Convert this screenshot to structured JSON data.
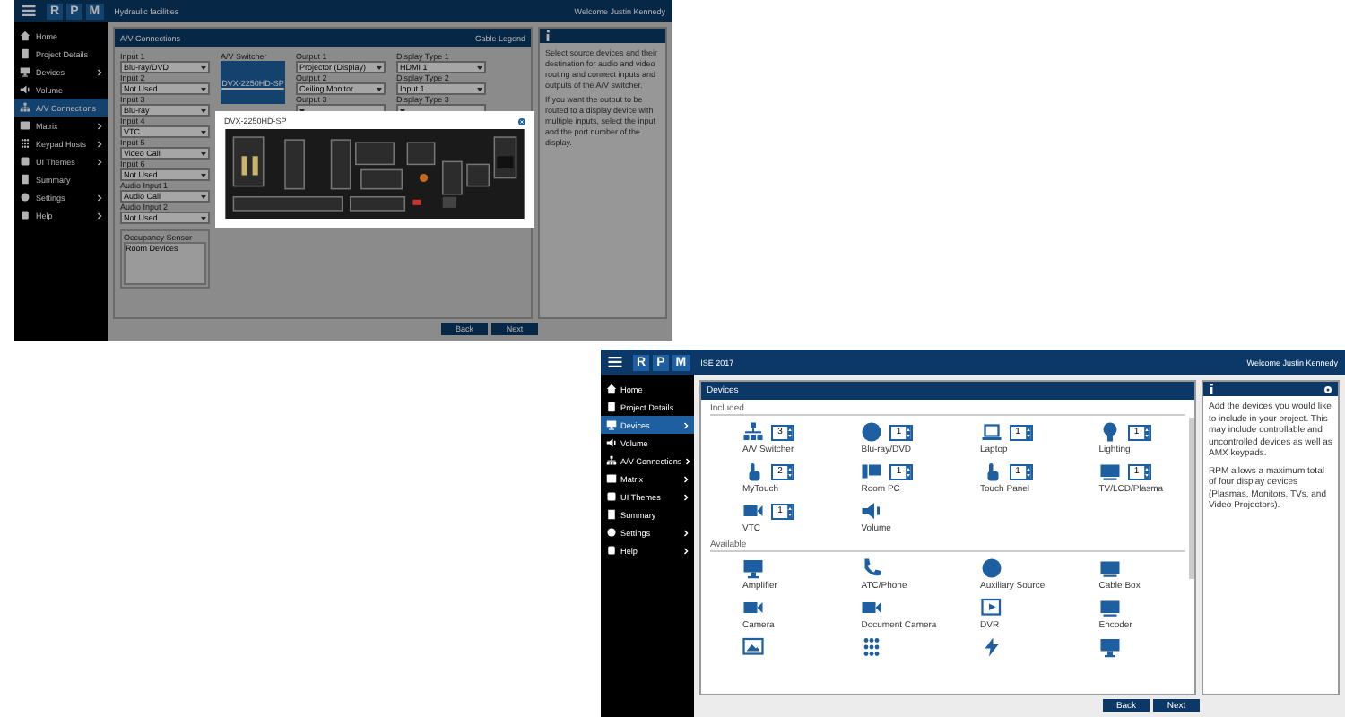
{
  "connections_screen": {
    "header": {
      "brand": [
        "R",
        "P",
        "M"
      ],
      "project": "Hydraulic facilities",
      "welcome": "Welcome Justin Kennedy"
    },
    "sidebar": [
      {
        "label": "Home",
        "selected": false,
        "has_submenu": false
      },
      {
        "label": "Project Details",
        "selected": false,
        "has_submenu": false
      },
      {
        "label": "Devices",
        "selected": false,
        "has_submenu": true
      },
      {
        "label": "Volume",
        "selected": false,
        "has_submenu": false
      },
      {
        "label": "A/V Connections",
        "selected": true,
        "has_submenu": false
      },
      {
        "label": "Matrix",
        "selected": false,
        "has_submenu": true
      },
      {
        "label": "Keypad Hosts",
        "selected": false,
        "has_submenu": true
      },
      {
        "label": "UI Themes",
        "selected": false,
        "has_submenu": true
      },
      {
        "label": "Summary",
        "selected": false,
        "has_submenu": false
      },
      {
        "label": "Settings",
        "selected": false,
        "has_submenu": true
      },
      {
        "label": "Help",
        "selected": false,
        "has_submenu": true
      }
    ],
    "panel_title": "A/V Connections",
    "legend_link": "Cable Legend",
    "inputs": [
      {
        "label": "Input 1",
        "value": "Blu-ray/DVD"
      },
      {
        "label": "Input 2",
        "value": "Not Used"
      },
      {
        "label": "Input 3",
        "value": "Blu-ray"
      },
      {
        "label": "Input 4",
        "value": "VTC"
      },
      {
        "label": "Input 5",
        "value": "Video Call"
      },
      {
        "label": "Input 6",
        "value": "Not Used"
      },
      {
        "label": "Audio Input 1",
        "value": "Audio Call"
      },
      {
        "label": "Audio Input 2",
        "value": "Not Used"
      }
    ],
    "switcher": {
      "label": "A/V Switcher",
      "name": "DVX-2250HD-SP"
    },
    "outputs": [
      {
        "label": "Output 1",
        "value": "Projector (Display)"
      },
      {
        "label": "Output 2",
        "value": "Ceiling Monitor"
      },
      {
        "label": "Output 3"
      }
    ],
    "displays": [
      {
        "label": "Display Type 1",
        "value": "HDMI 1"
      },
      {
        "label": "Display Type 2",
        "value": "Input 1"
      },
      {
        "label": "Display Type 3"
      }
    ],
    "sensor_group": {
      "title": "Occupancy Sensor",
      "value": "Room Devices"
    },
    "info": [
      "Select source devices and their destination for audio and video routing and connect inputs and outputs of the A/V switcher.",
      "If you want the output to be routed to a display device with multiple inputs, select the input and the port number of the display."
    ],
    "modal": {
      "title": "DVX-2250HD-SP"
    },
    "buttons": [
      "Back",
      "Next"
    ]
  },
  "devices_screen": {
    "header": {
      "brand": [
        "R",
        "P",
        "M"
      ],
      "project": "ISE 2017",
      "welcome": "Welcome Justin Kennedy"
    },
    "sidebar": [
      {
        "label": "Home",
        "selected": false,
        "has_submenu": false
      },
      {
        "label": "Project Details",
        "selected": false,
        "has_submenu": false
      },
      {
        "label": "Devices",
        "selected": true,
        "has_submenu": true
      },
      {
        "label": "Volume",
        "selected": false,
        "has_submenu": false
      },
      {
        "label": "A/V Connections",
        "selected": false,
        "has_submenu": true
      },
      {
        "label": "Matrix",
        "selected": false,
        "has_submenu": true
      },
      {
        "label": "UI Themes",
        "selected": false,
        "has_submenu": true
      },
      {
        "label": "Summary",
        "selected": false,
        "has_submenu": false
      },
      {
        "label": "Settings",
        "selected": false,
        "has_submenu": true
      },
      {
        "label": "Help",
        "selected": false,
        "has_submenu": true
      }
    ],
    "panel_title": "Devices",
    "included_title": "Included",
    "included": [
      {
        "label": "A/V Switcher",
        "count": "3"
      },
      {
        "label": "Blu-ray/DVD",
        "count": "1"
      },
      {
        "label": "Laptop",
        "count": "1"
      },
      {
        "label": "Lighting",
        "count": "1"
      },
      {
        "label": "MyTouch",
        "count": "2"
      },
      {
        "label": "Room PC",
        "count": "1"
      },
      {
        "label": "Touch Panel",
        "count": "1"
      },
      {
        "label": "TV/LCD/Plasma",
        "count": "1"
      },
      {
        "label": "VTC",
        "count": "1"
      },
      {
        "label": "Volume"
      }
    ],
    "available_title": "Available",
    "available": [
      "Amplifier",
      "ATC/Phone",
      "Auxiliary Source",
      "Cable Box",
      "Camera",
      "Document Camera",
      "DVR",
      "Encoder"
    ],
    "info": [
      "Add the devices you would like to include in your project. This may include controllable and uncontrolled devices as well as AMX keypads.",
      "RPM allows a maximum total of four display devices (Plasmas, Monitors, TVs, and Video Projectors)."
    ],
    "buttons": [
      "Back",
      "Next"
    ]
  }
}
